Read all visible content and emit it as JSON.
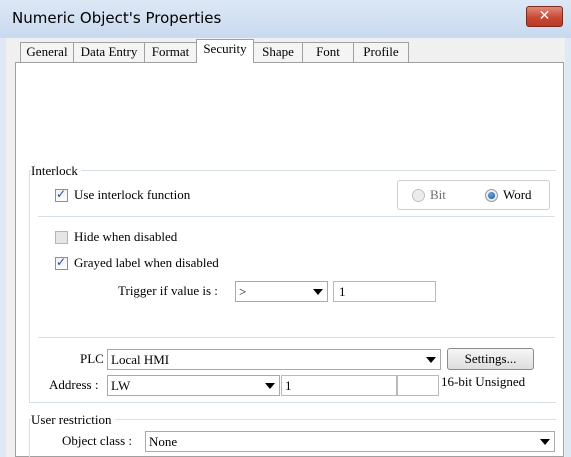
{
  "window": {
    "title": "Numeric Object's Properties",
    "close_glyph": "✕"
  },
  "tabs": [
    {
      "label": "General",
      "active": false
    },
    {
      "label": "Data Entry",
      "active": false
    },
    {
      "label": "Format",
      "active": false
    },
    {
      "label": "Security",
      "active": true
    },
    {
      "label": "Shape",
      "active": false
    },
    {
      "label": "Font",
      "active": false
    },
    {
      "label": "Profile",
      "active": false
    }
  ],
  "interlock": {
    "group_label": "Interlock",
    "use_interlock": {
      "label": "Use interlock function",
      "checked": true
    },
    "mode": {
      "bit_label": "Bit",
      "word_label": "Word",
      "selected": "Word"
    },
    "hide_when_disabled": {
      "label": "Hide when disabled",
      "checked": false
    },
    "grayed_label": {
      "label": "Grayed label when disabled",
      "checked": true
    },
    "trigger": {
      "label": "Trigger if value is :",
      "operator": ">",
      "value": "1"
    },
    "plc": {
      "label": "PLC :",
      "value": "Local HMI",
      "settings_label": "Settings..."
    },
    "address": {
      "label": "Address :",
      "device": "LW",
      "value": "1",
      "extra": "",
      "data_type": "16-bit Unsigned"
    }
  },
  "user_restriction": {
    "group_label": "User restriction",
    "object_class": {
      "label": "Object class :",
      "value": "None"
    }
  },
  "icons": {
    "checkmark": "✓"
  }
}
